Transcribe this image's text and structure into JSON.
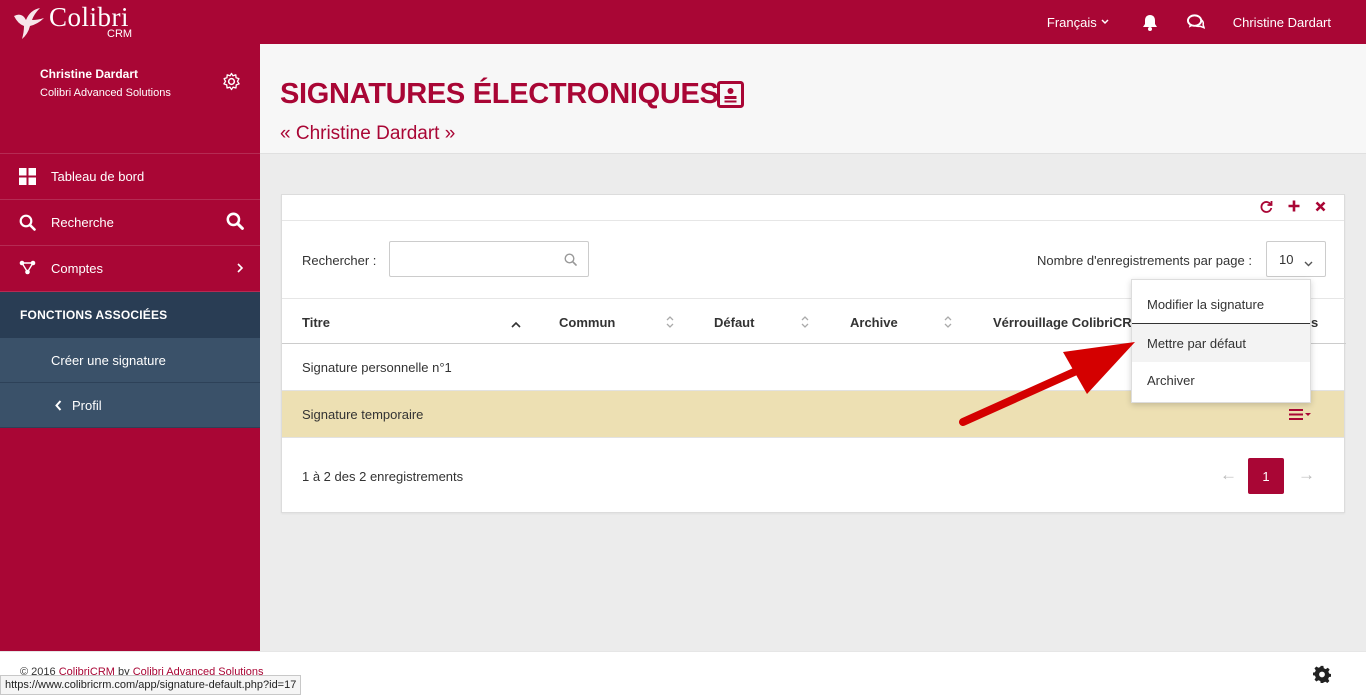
{
  "app": {
    "name": "Colibri",
    "sub": "CRM"
  },
  "topbar": {
    "language": "Français",
    "user": "Christine Dardart"
  },
  "sidebar": {
    "profile": {
      "name": "Christine Dardart",
      "company": "Colibri Advanced Solutions"
    },
    "items": [
      {
        "label": "Tableau de bord",
        "icon": "dashboard-icon"
      },
      {
        "label": "Recherche",
        "icon": "search-icon"
      },
      {
        "label": "Comptes",
        "icon": "accounts-icon"
      }
    ],
    "section_title": "FONCTIONS ASSOCIÉES",
    "sub_items": [
      {
        "label": "Créer une signature"
      },
      {
        "label": "Profil"
      }
    ]
  },
  "page": {
    "title": "SIGNATURES ÉLECTRONIQUES",
    "subtitle": "« Christine Dardart »"
  },
  "table": {
    "search_label": "Rechercher :",
    "search_value": "",
    "search_placeholder": "",
    "perpage_label": "Nombre d'enregistrements par page :",
    "perpage_value": "10",
    "columns": [
      "Titre",
      "Commun",
      "Défaut",
      "Archive",
      "Vérrouillage ColibriCRM",
      "s"
    ],
    "rows": [
      {
        "title": "Signature personnelle n°1"
      },
      {
        "title": "Signature temporaire"
      }
    ],
    "info": "1 à 2 des 2 enregistrements",
    "pagination": {
      "prev": "←",
      "current": "1",
      "next": "→"
    }
  },
  "dropdown": {
    "items": [
      "Modifier la signature",
      "Mettre par défaut",
      "Archiver"
    ],
    "highlighted": "Mettre par défaut"
  },
  "footer": {
    "copyright_prefix": "© 2016",
    "copyright_link1": "ColibriCRM",
    "copyright_mid": "by",
    "copyright_link2": "Colibri Advanced Solutions"
  },
  "statusbar": {
    "url": "https://www.colibricrm.com/app/signature-default.php?id=17"
  },
  "colors": {
    "brand": "#a90635",
    "nav_dark": "#293d54",
    "nav_sub": "#3a5169",
    "row_highlight": "#ede0b3",
    "arrow": "#d40000"
  }
}
